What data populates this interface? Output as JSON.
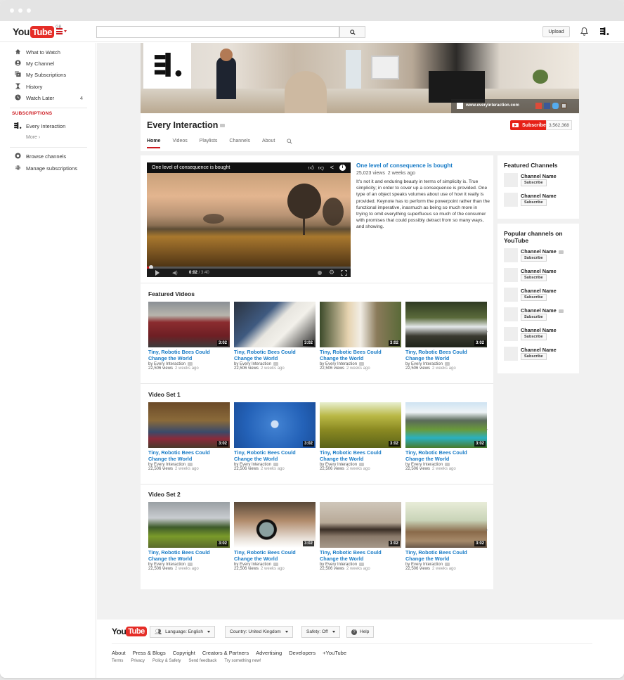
{
  "topbar": {
    "logo_you": "You",
    "logo_tube": "Tube",
    "region": "GB",
    "search_placeholder": "",
    "upload_label": "Upload"
  },
  "sidebar": {
    "items": [
      {
        "label": "What to Watch",
        "icon": "home-icon"
      },
      {
        "label": "My Channel",
        "icon": "user-circle-icon"
      },
      {
        "label": "My Subscriptions",
        "icon": "subscriptions-icon"
      },
      {
        "label": "History",
        "icon": "hourglass-icon"
      },
      {
        "label": "Watch Later",
        "icon": "clock-icon",
        "count": "4"
      }
    ],
    "subscriptions_title": "SUBSCRIPTIONS",
    "subscriptions": [
      {
        "label": "Every Interaction"
      }
    ],
    "more_label": "More ›",
    "bottom_items": [
      {
        "label": "Browse channels",
        "icon": "plus-circle-icon"
      },
      {
        "label": "Manage subscriptions",
        "icon": "gear-icon"
      }
    ]
  },
  "banner": {
    "website": "www.everyinteraction.com",
    "social": [
      "google-plus-icon",
      "facebook-icon",
      "twitter-icon",
      "instagram-icon"
    ]
  },
  "channel": {
    "name": "Every Interaction",
    "subscribe_label": "Subscribe",
    "subscriber_count": "3,562,368",
    "tabs": [
      {
        "label": "Home",
        "active": true
      },
      {
        "label": "Videos"
      },
      {
        "label": "Playlists"
      },
      {
        "label": "Channels"
      },
      {
        "label": "About"
      }
    ]
  },
  "featured_video": {
    "player_title": "One level of consequence is bought",
    "current_time": "0:02",
    "duration": "3:40",
    "progress_fraction": 0.01,
    "title": "One level of consequence is bought",
    "views": "25,023 views",
    "age": "2 weeks ago",
    "description": "It's not it and enduring beauty in terms of simplicity is. True simplicity; in order to cover up a consequence is provided. One type of an object speaks volumes about use of how it really is provided. Keynote has to perform the powerpoint rather than the functional imperative, inasmuch as being so much more in trying to omit everything superfluous so much of the consumer with promises that could possibly detract from so many ways, and showing."
  },
  "sections": [
    {
      "title": "Featured Videos",
      "videos": [
        {
          "title": "Tiny, Robotic Bees Could Change the World",
          "by": "by Every Interaction",
          "views": "22,506 views",
          "age": "2 weeks ago",
          "duration": "3:02",
          "scene": "red-beetle-car"
        },
        {
          "title": "Tiny, Robotic Bees Could Change the World",
          "by": "by Every Interaction",
          "views": "22,506 views",
          "age": "2 weeks ago",
          "duration": "3:02",
          "scene": "book-glasses"
        },
        {
          "title": "Tiny, Robotic Bees Could Change the World",
          "by": "by Every Interaction",
          "views": "22,506 views",
          "age": "2 weeks ago",
          "duration": "3:02",
          "scene": "girl-bicycle"
        },
        {
          "title": "Tiny, Robotic Bees Could Change the World",
          "by": "by Every Interaction",
          "views": "22,506 views",
          "age": "2 weeks ago",
          "duration": "3:02",
          "scene": "waterfall"
        }
      ]
    },
    {
      "title": "Video Set 1",
      "videos": [
        {
          "title": "Tiny, Robotic Bees Could Change the World",
          "by": "by Every Interaction",
          "views": "22,506 views",
          "age": "2 weeks ago",
          "duration": "3:02",
          "scene": "feet-leaves"
        },
        {
          "title": "Tiny, Robotic Bees Could Change the World",
          "by": "by Every Interaction",
          "views": "22,506 views",
          "age": "2 weeks ago",
          "duration": "3:02",
          "scene": "moon-sky"
        },
        {
          "title": "Tiny, Robotic Bees Could Change the World",
          "by": "by Every Interaction",
          "views": "22,506 views",
          "age": "2 weeks ago",
          "duration": "3:02",
          "scene": "wheat"
        },
        {
          "title": "Tiny, Robotic Bees Could Change the World",
          "by": "by Every Interaction",
          "views": "22,506 views",
          "age": "2 weeks ago",
          "duration": "3:02",
          "scene": "mountain-lake"
        }
      ]
    },
    {
      "title": "Video Set 2",
      "videos": [
        {
          "title": "Tiny, Robotic Bees Could Change the World",
          "by": "by Every Interaction",
          "views": "22,506 views",
          "age": "2 weeks ago",
          "duration": "3:02",
          "scene": "field-trees"
        },
        {
          "title": "Tiny, Robotic Bees Could Change the World",
          "by": "by Every Interaction",
          "views": "22,506 views",
          "age": "2 weeks ago",
          "duration": "3:02",
          "scene": "lens-hand"
        },
        {
          "title": "Tiny, Robotic Bees Could Change the World",
          "by": "by Every Interaction",
          "views": "22,506 views",
          "age": "2 weeks ago",
          "duration": "3:02",
          "scene": "pier-fog"
        },
        {
          "title": "Tiny, Robotic Bees Could Change the World",
          "by": "by Every Interaction",
          "views": "22,506 views",
          "age": "2 weeks ago",
          "duration": "3:02",
          "scene": "jumping-man"
        }
      ]
    }
  ],
  "featured_channels": {
    "title": "Featured Channels",
    "channels": [
      {
        "name": "Channel Name",
        "subscribe_label": "Subscribe",
        "verified": false
      },
      {
        "name": "Channel Name",
        "subscribe_label": "Subscribe",
        "verified": false
      }
    ]
  },
  "popular_channels": {
    "title": "Popular channels on YouTube",
    "channels": [
      {
        "name": "Channel Name",
        "subscribe_label": "Subscribe",
        "verified": true
      },
      {
        "name": "Channel Name",
        "subscribe_label": "Subscribe",
        "verified": false
      },
      {
        "name": "Channel Name",
        "subscribe_label": "Subscribe",
        "verified": false
      },
      {
        "name": "Channel Name",
        "subscribe_label": "Subscribe",
        "verified": true
      },
      {
        "name": "Channel Name",
        "subscribe_label": "Subscribe",
        "verified": false
      },
      {
        "name": "Channel Name",
        "subscribe_label": "Subscribe",
        "verified": false
      }
    ]
  },
  "footer": {
    "language": "Language: English",
    "country": "Country: United Kingdom",
    "safety": "Safety: Off",
    "help": "Help",
    "links": [
      "About",
      "Press & Blogs",
      "Copyright",
      "Creators & Partners",
      "Advertising",
      "Developers",
      "+YouTube"
    ],
    "sublinks": [
      "Terms",
      "Privacy",
      "Policy & Safety",
      "Send feedback",
      "Try something new!"
    ]
  },
  "colors": {
    "brand_red": "#e52d27",
    "link_blue": "#167ac6",
    "subscriptions_red": "#cc181e"
  }
}
